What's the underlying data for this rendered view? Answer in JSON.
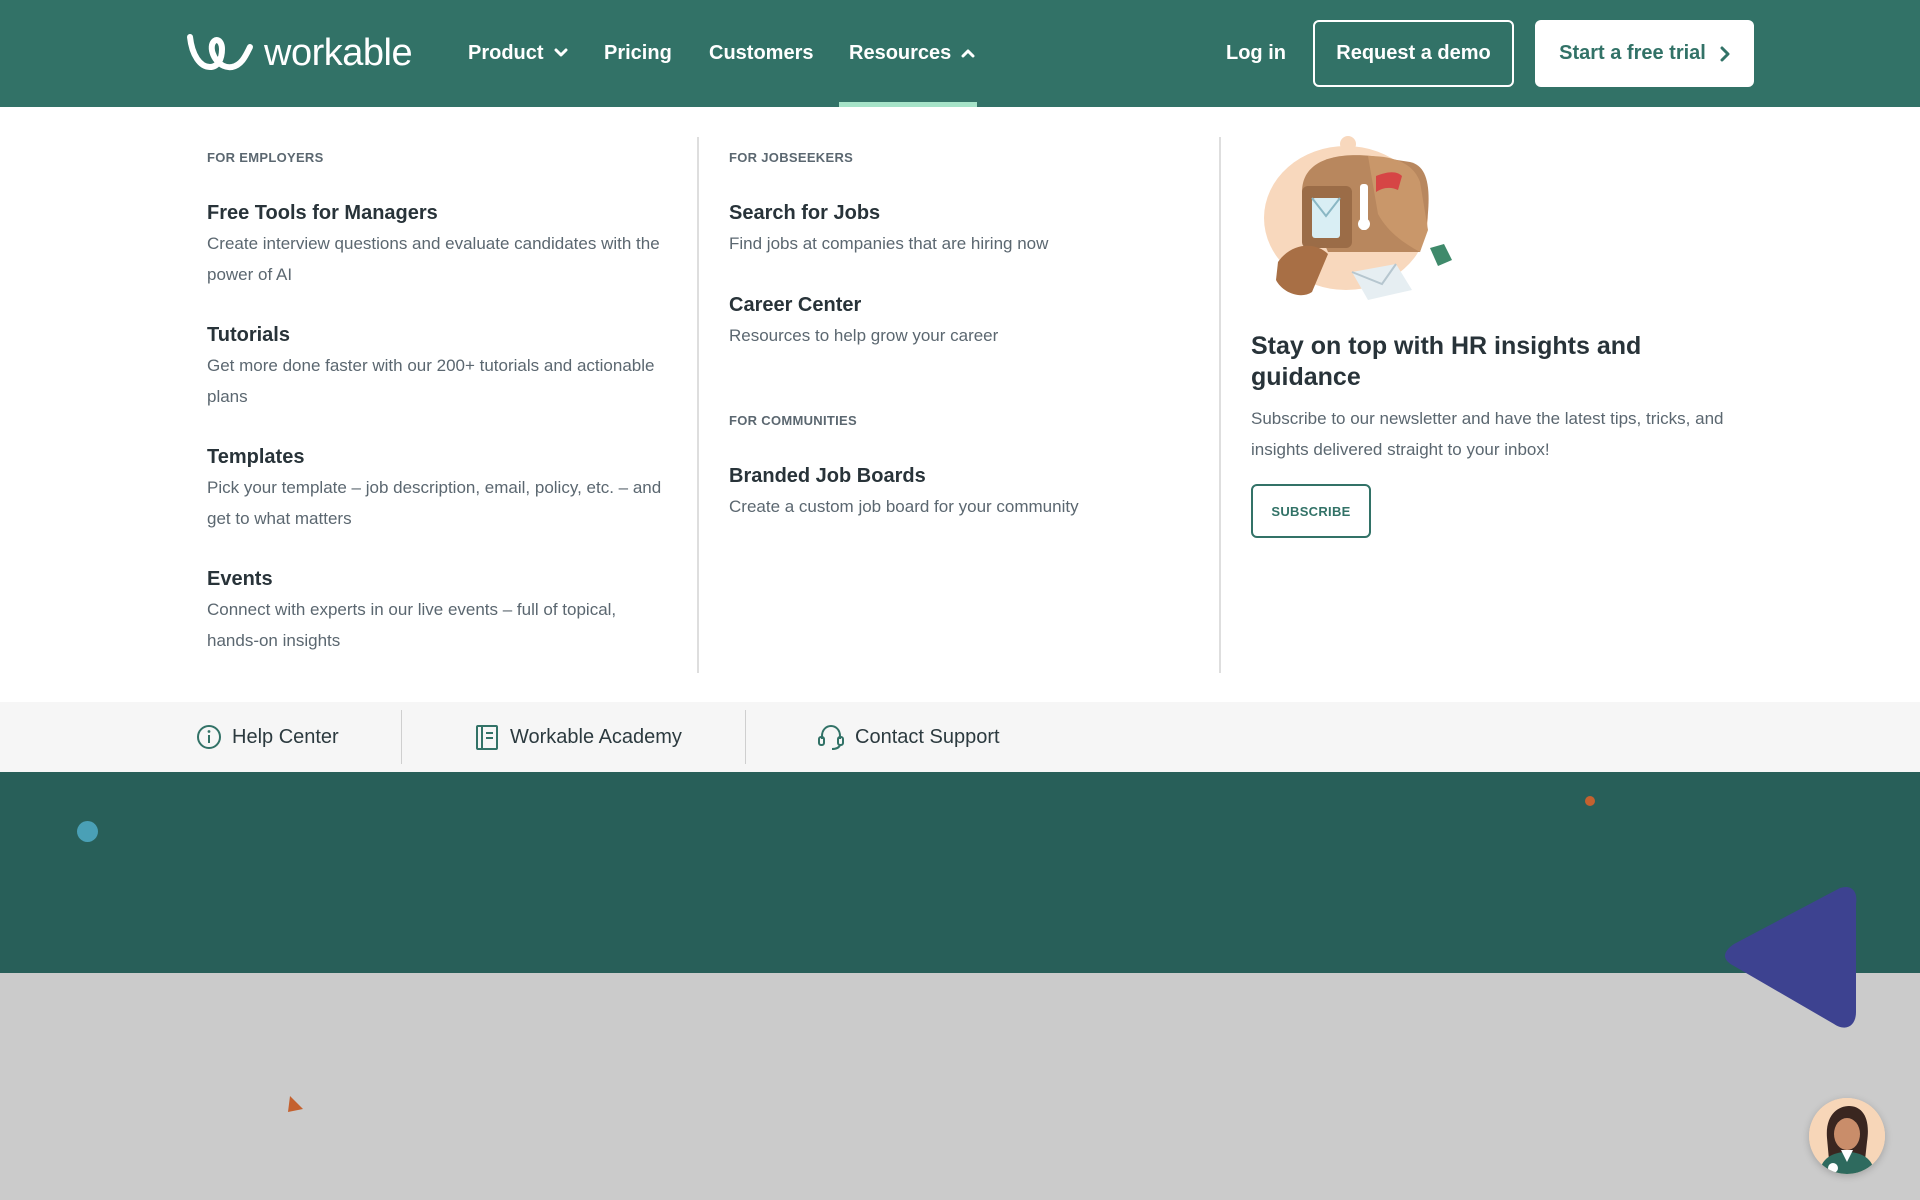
{
  "brand": {
    "name": "workable"
  },
  "nav": {
    "product": "Product",
    "pricing": "Pricing",
    "customers": "Customers",
    "resources": "Resources",
    "login": "Log in",
    "demo": "Request a demo",
    "trial": "Start a free trial"
  },
  "employers": {
    "heading": "FOR EMPLOYERS",
    "items": [
      {
        "title": "Free Tools for Managers",
        "desc": "Create interview questions and evaluate candidates with the power of AI"
      },
      {
        "title": "Tutorials",
        "desc": "Get more done faster with our 200+ tutorials and actionable plans"
      },
      {
        "title": "Templates",
        "desc": "Pick your template – job description, email, policy, etc. – and get to what matters"
      },
      {
        "title": "Events",
        "desc": "Connect with experts in our live events – full of topical, hands-on insights"
      }
    ]
  },
  "jobseekers": {
    "heading": "FOR JOBSEEKERS",
    "items": [
      {
        "title": "Search for Jobs",
        "desc": "Find jobs at companies that are hiring now"
      },
      {
        "title": "Career Center",
        "desc": "Resources to help grow your career"
      }
    ]
  },
  "communities": {
    "heading": "FOR COMMUNITIES",
    "items": [
      {
        "title": "Branded Job Boards",
        "desc": "Create a custom job board for your community"
      }
    ]
  },
  "promo": {
    "title": "Stay on top with HR insights and guidance",
    "desc": "Subscribe to our newsletter and have the latest tips, tricks, and insights delivered straight to your inbox!",
    "button": "SUBSCRIBE"
  },
  "support": {
    "help": "Help Center",
    "academy": "Workable Academy",
    "contact": "Contact Support"
  },
  "icons": {
    "chevron_down": "chevron-down-icon",
    "chevron_up": "chevron-up-icon",
    "chevron_right": "chevron-right-icon",
    "info": "info-icon",
    "book": "book-icon",
    "headset": "headset-icon",
    "mailbox": "mailbox-illustration"
  },
  "colors": {
    "brand_green": "#327267",
    "hero_green": "#285f59",
    "accent_underline": "#a6e3c8",
    "deco_purple": "#3d4290",
    "deco_orange": "#c4612f",
    "deco_blue": "#4aa0b6"
  }
}
